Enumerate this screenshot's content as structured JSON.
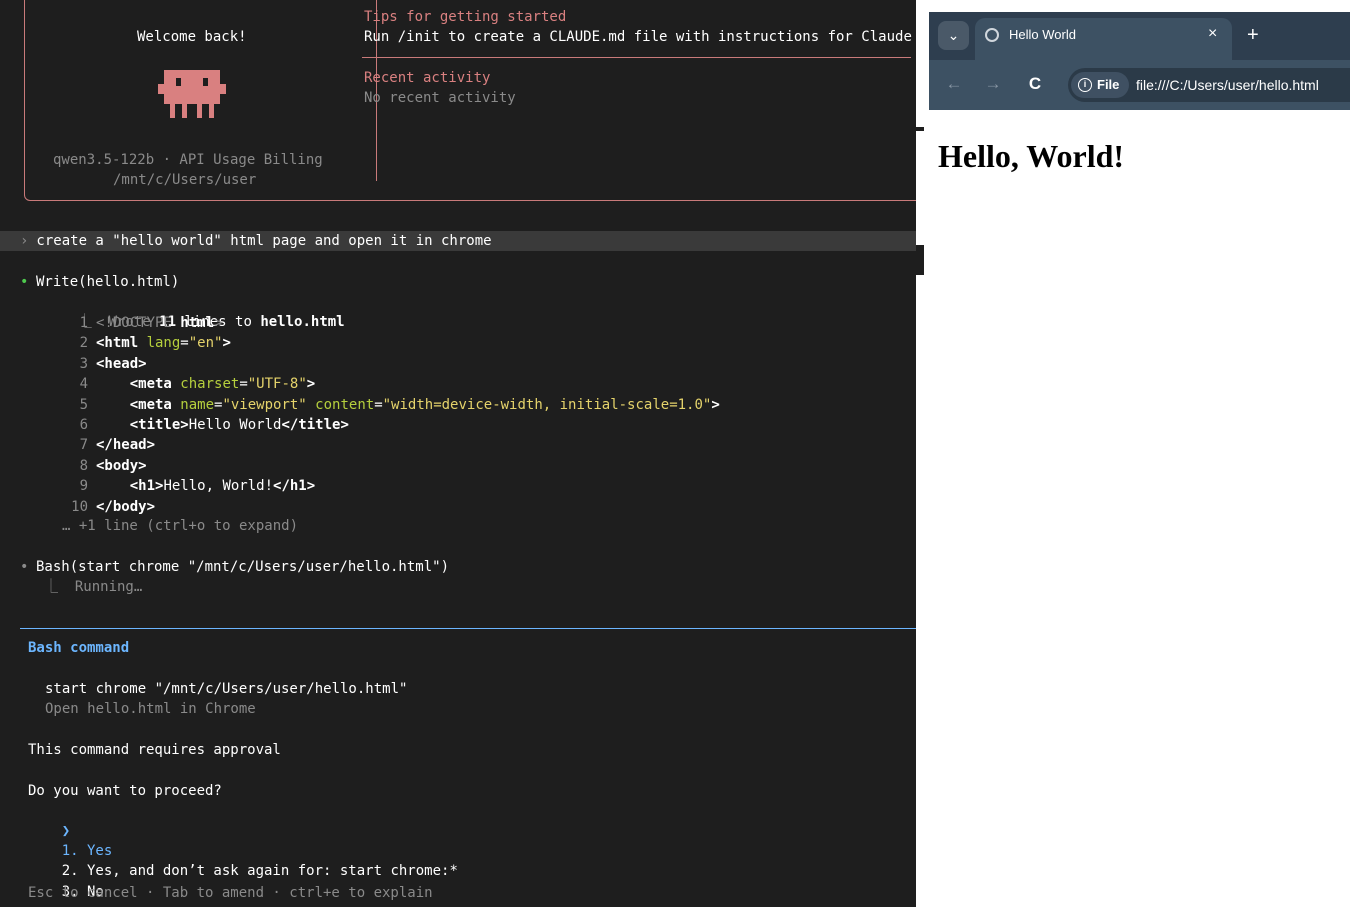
{
  "terminal": {
    "welcome": {
      "title": "Welcome back!",
      "model_line": "qwen3.5-122b · API Usage Billing",
      "cwd": "/mnt/c/Users/user"
    },
    "tips": {
      "heading": "Tips for getting started",
      "text": "Run /init to create a CLAUDE.md file with instructions for Claude"
    },
    "recent": {
      "heading": "Recent activity",
      "text": "No recent activity"
    },
    "prompt": {
      "caret": "›",
      "text": " create a \"hello world\" html page and open it in chrome"
    },
    "write": {
      "bullet": "•",
      "call": "Write(hello.html)",
      "result_prefix": "⎿  Wrote ",
      "result_count": "11",
      "result_mid": " lines to ",
      "result_file": "hello.html",
      "code": [
        {
          "num": "1",
          "parts": [
            {
              "t": "<!DOCTYPE ",
              "c": "muted"
            },
            {
              "t": "html",
              "c": "bold"
            },
            {
              "t": ">",
              "c": "muted"
            }
          ]
        },
        {
          "num": "2",
          "parts": [
            {
              "t": "<html ",
              "c": "bold"
            },
            {
              "t": "lang",
              "c": "attr"
            },
            {
              "t": "=",
              "c": "white"
            },
            {
              "t": "\"en\"",
              "c": "val"
            },
            {
              "t": ">",
              "c": "bold"
            }
          ]
        },
        {
          "num": "3",
          "parts": [
            {
              "t": "<head>",
              "c": "bold"
            }
          ]
        },
        {
          "num": "4",
          "parts": [
            {
              "t": "    <meta ",
              "c": "bold"
            },
            {
              "t": "charset",
              "c": "attr"
            },
            {
              "t": "=",
              "c": "white"
            },
            {
              "t": "\"UTF-8\"",
              "c": "val"
            },
            {
              "t": ">",
              "c": "bold"
            }
          ]
        },
        {
          "num": "5",
          "parts": [
            {
              "t": "    <meta ",
              "c": "bold"
            },
            {
              "t": "name",
              "c": "attr"
            },
            {
              "t": "=",
              "c": "white"
            },
            {
              "t": "\"viewport\" ",
              "c": "val"
            },
            {
              "t": "content",
              "c": "attr"
            },
            {
              "t": "=",
              "c": "white"
            },
            {
              "t": "\"width=device-width, initial-scale=1.0\"",
              "c": "val"
            },
            {
              "t": ">",
              "c": "bold"
            }
          ]
        },
        {
          "num": "6",
          "parts": [
            {
              "t": "    <title>",
              "c": "bold"
            },
            {
              "t": "Hello World",
              "c": "white"
            },
            {
              "t": "</title>",
              "c": "bold"
            }
          ]
        },
        {
          "num": "7",
          "parts": [
            {
              "t": "</head>",
              "c": "bold"
            }
          ]
        },
        {
          "num": "8",
          "parts": [
            {
              "t": "<body>",
              "c": "bold"
            }
          ]
        },
        {
          "num": "9",
          "parts": [
            {
              "t": "    <h1>",
              "c": "bold"
            },
            {
              "t": "Hello, World!",
              "c": "white"
            },
            {
              "t": "</h1>",
              "c": "bold"
            }
          ]
        },
        {
          "num": "10",
          "parts": [
            {
              "t": "</body>",
              "c": "bold"
            }
          ]
        }
      ],
      "expand_hint": "… +1 line (ctrl+o to expand)"
    },
    "bash": {
      "bullet": "•",
      "call": "Bash(start chrome \"/mnt/c/Users/user/hello.html\")",
      "status": "⎿  Running…"
    },
    "permission": {
      "title": "Bash command",
      "command": "start chrome \"/mnt/c/Users/user/hello.html\"",
      "description": "Open hello.html in Chrome",
      "notice": "This command requires approval",
      "question": "Do you want to proceed?",
      "options": [
        {
          "pointer": "❯",
          "label": "1. Yes"
        },
        {
          "pointer": " ",
          "label": "2. Yes, and don’t ask again for: start chrome:*"
        },
        {
          "pointer": " ",
          "label": "3. No"
        }
      ],
      "footer": "Esc to cancel · Tab to amend · ctrl+e to explain"
    },
    "colors": {
      "background": "#1e1e1e",
      "accent": "#d98080",
      "selection": "#6cb6ff"
    }
  },
  "browser": {
    "tab_title": "Hello World",
    "close_glyph": "×",
    "new_tab_glyph": "+",
    "menu_glyph": "⌄",
    "back_glyph": "←",
    "forward_glyph": "→",
    "reload_glyph": "C",
    "site_chip_label": "File",
    "url": "file:///C:/Users/user/hello.html",
    "page_heading": "Hello, World!",
    "colors": {
      "tabstrip": "#2e3e4f",
      "toolbar": "#3d5163"
    }
  }
}
